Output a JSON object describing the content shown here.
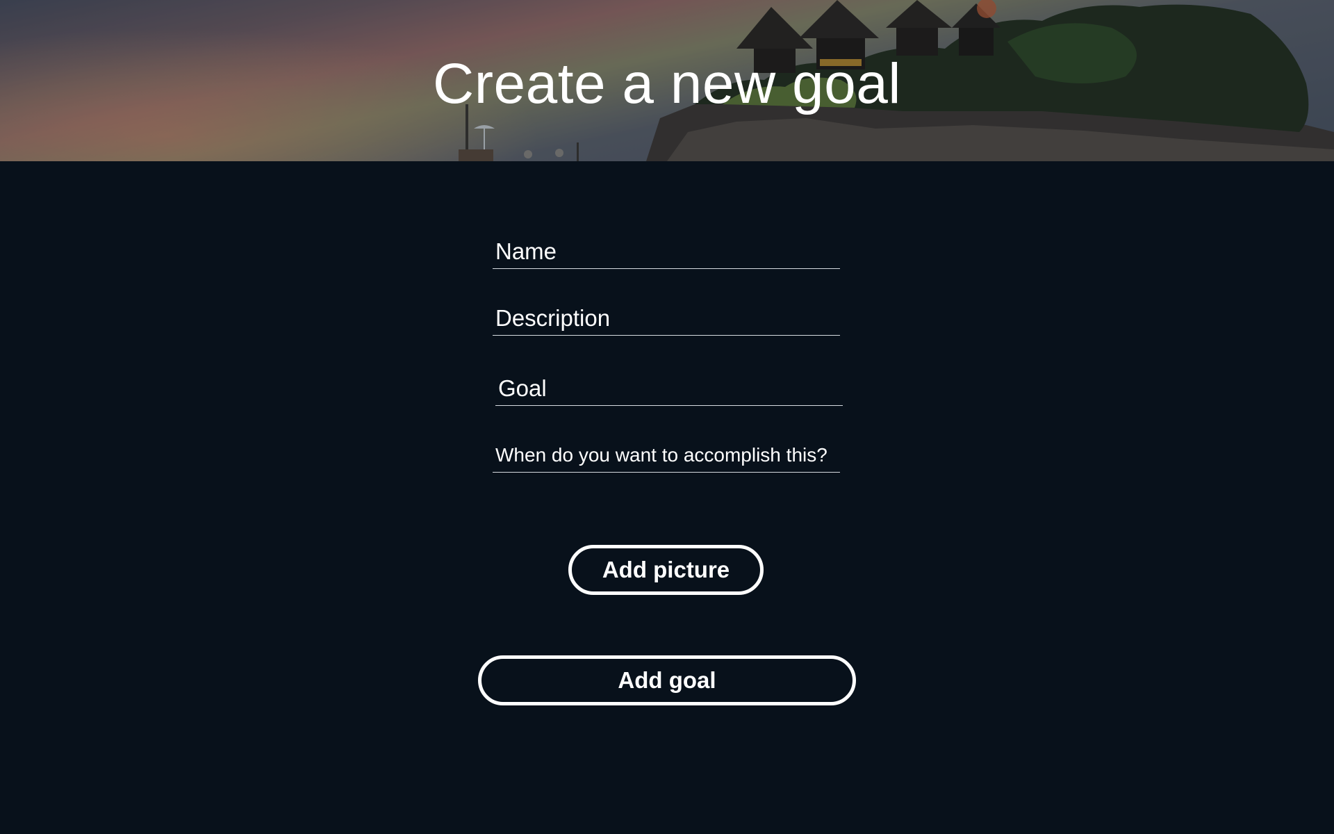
{
  "header": {
    "title": "Create a new goal"
  },
  "form": {
    "name": {
      "placeholder": "Name",
      "value": ""
    },
    "description": {
      "placeholder": "Description",
      "value": ""
    },
    "goal": {
      "placeholder": "Goal",
      "value": ""
    },
    "deadline": {
      "placeholder": "When do you want to accomplish this?",
      "value": ""
    }
  },
  "actions": {
    "add_picture_label": "Add picture",
    "add_goal_label": "Add goal"
  },
  "colors": {
    "background": "#08111b",
    "text": "#ffffff",
    "field_underline": "#d7dce1"
  }
}
